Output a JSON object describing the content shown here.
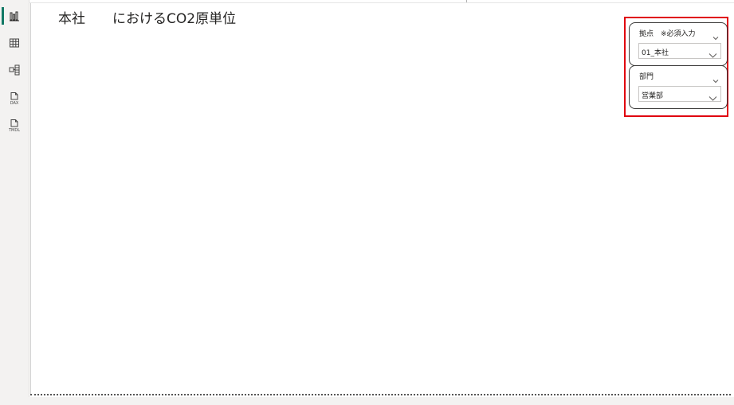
{
  "report": {
    "title": "本社　　におけるCO2原単位"
  },
  "rail": {
    "items": [
      {
        "icon": "report-view-icon",
        "active": true
      },
      {
        "icon": "table-view-icon",
        "active": false
      },
      {
        "icon": "model-view-icon",
        "active": false
      },
      {
        "icon": "dax-query-view-icon",
        "active": false,
        "sublabel": "DAX"
      },
      {
        "icon": "tmdl-view-icon",
        "active": false,
        "sublabel": "TMDL"
      }
    ]
  },
  "slicers": [
    {
      "header": "拠点　※必須入力",
      "value": "01_本社"
    },
    {
      "header": "部門",
      "value": "営業部"
    }
  ],
  "colors": {
    "accent": "#117865",
    "highlight": "#e0000e",
    "rail_bg": "#f3f2f1"
  }
}
